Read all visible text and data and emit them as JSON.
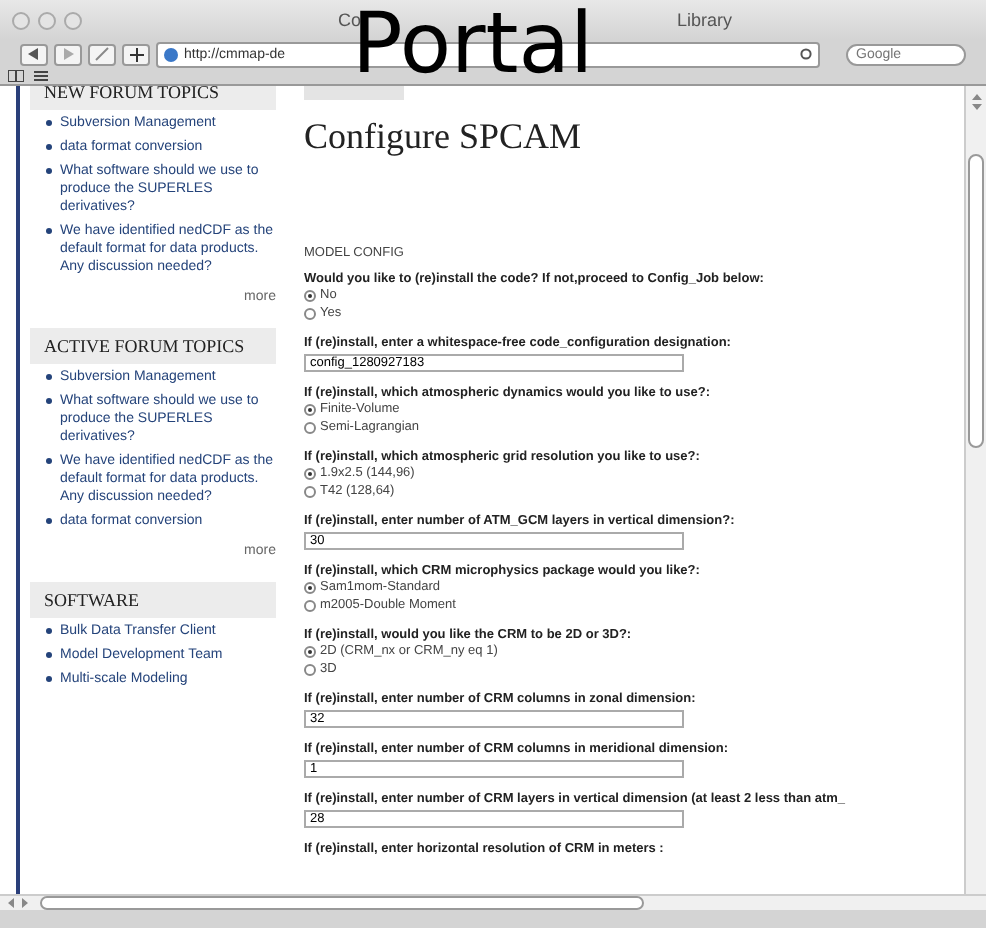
{
  "window": {
    "title_parts": [
      "Co",
      "Library"
    ]
  },
  "overlay_caption": "Portal",
  "toolbar": {
    "url": "http://cmmap-de",
    "search": {
      "placeholder": "Google"
    }
  },
  "sidebar": {
    "blocks": [
      {
        "title": "NEW FORUM TOPICS",
        "items": [
          "Subversion Management",
          "data format conversion",
          "What software should we use to produce the SUPERLES derivatives?",
          "We have identified nedCDF as the default format for data products. Any discussion needed?"
        ],
        "more": "more"
      },
      {
        "title": "ACTIVE FORUM TOPICS",
        "items": [
          "Subversion Management",
          "What software should we use to produce the SUPERLES derivatives?",
          "We have identified nedCDF as the default format for data products. Any discussion needed?",
          "data format conversion"
        ],
        "more": "more"
      },
      {
        "title": "SOFTWARE",
        "items": [
          "Bulk Data Transfer Client",
          "Model Development Team",
          "Multi-scale Modeling"
        ]
      }
    ]
  },
  "main": {
    "heading": "Configure SPCAM",
    "section": "MODEL CONFIG",
    "questions": [
      {
        "kind": "radio",
        "label": "Would you like to (re)install the code? If not,proceed to Config_Job below:",
        "options": [
          {
            "label": "No",
            "selected": true
          },
          {
            "label": "Yes",
            "selected": false
          }
        ]
      },
      {
        "kind": "text",
        "label": "If (re)install, enter a whitespace-free code_configuration designation:",
        "value": "config_1280927183"
      },
      {
        "kind": "radio",
        "label": "If (re)install, which atmospheric dynamics would you like to use?:",
        "options": [
          {
            "label": "Finite-Volume",
            "selected": true
          },
          {
            "label": "Semi-Lagrangian",
            "selected": false
          }
        ]
      },
      {
        "kind": "radio",
        "label": "If (re)install, which atmospheric grid resolution you like to use?:",
        "options": [
          {
            "label": "1.9x2.5 (144,96)",
            "selected": true
          },
          {
            "label": "T42 (128,64)",
            "selected": false
          }
        ]
      },
      {
        "kind": "text",
        "label": "If (re)install, enter number of ATM_GCM layers in vertical dimension?:",
        "value": "30"
      },
      {
        "kind": "radio",
        "label": "If (re)install, which CRM microphysics package would you like?:",
        "options": [
          {
            "label": "Sam1mom-Standard",
            "selected": true
          },
          {
            "label": "m2005-Double Moment",
            "selected": false
          }
        ]
      },
      {
        "kind": "radio",
        "label": "If (re)install, would you like the CRM to be 2D or 3D?:",
        "options": [
          {
            "label": "2D (CRM_nx or CRM_ny eq 1)",
            "selected": true
          },
          {
            "label": "3D",
            "selected": false
          }
        ]
      },
      {
        "kind": "text",
        "label": "If (re)install, enter number of CRM columns in zonal dimension:",
        "value": "32"
      },
      {
        "kind": "text",
        "label": "If (re)install, enter number of CRM columns in meridional dimension:",
        "value": "1"
      },
      {
        "kind": "text",
        "label": "If (re)install, enter number of CRM layers in vertical dimension (at least 2 less than atm_",
        "value": "28"
      },
      {
        "kind": "text",
        "label": "If (re)install, enter horizontal resolution of CRM in meters :"
      }
    ]
  }
}
